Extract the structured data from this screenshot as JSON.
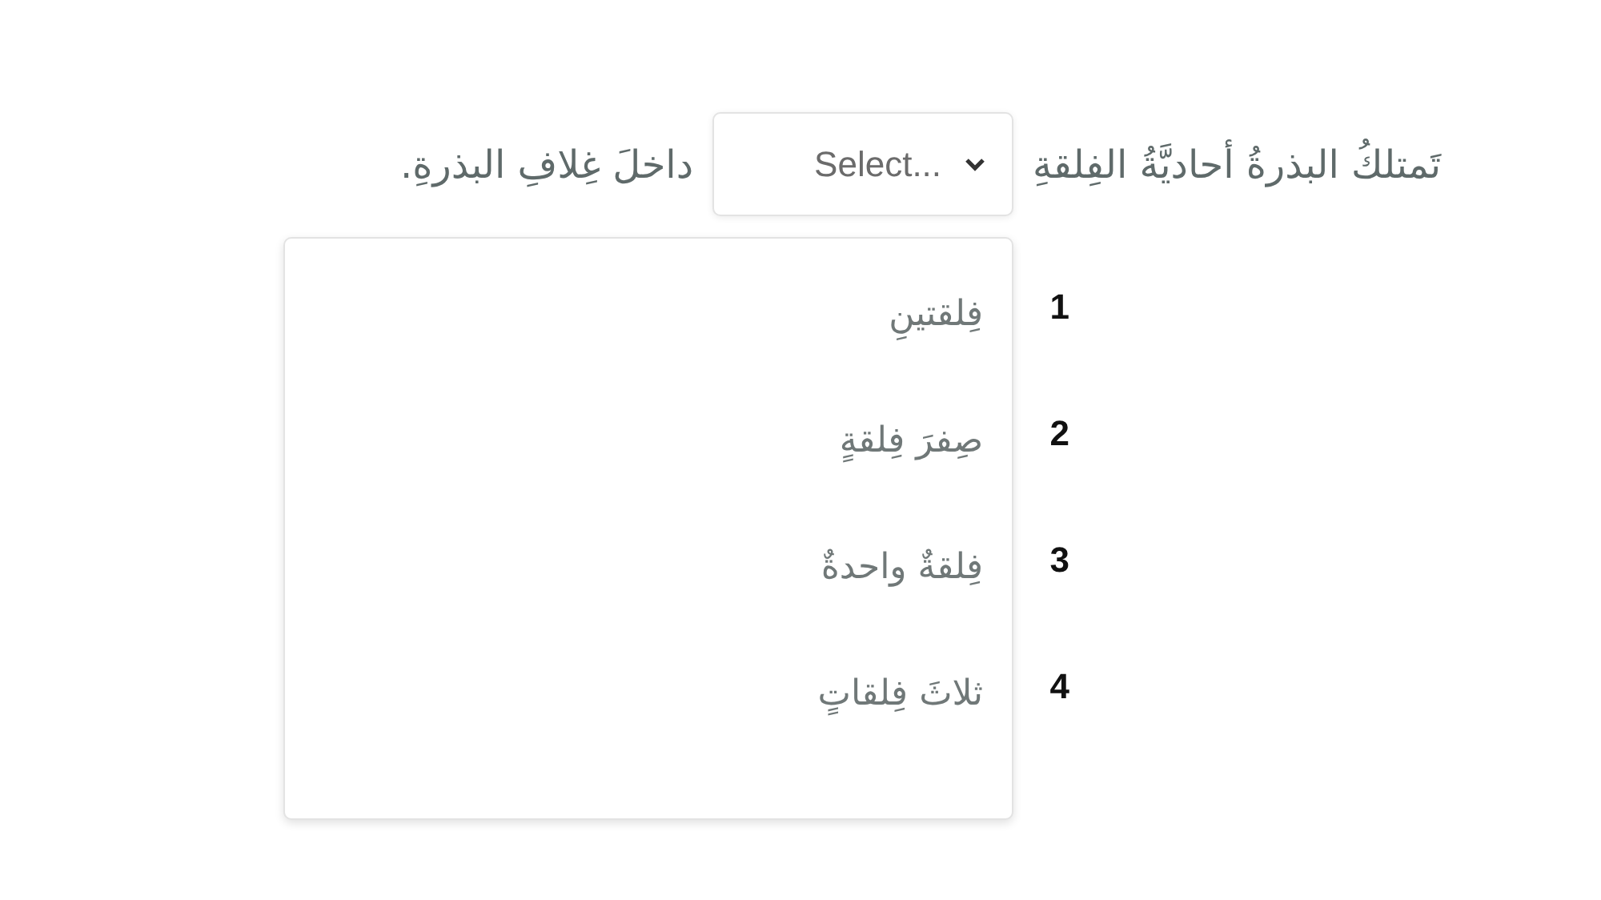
{
  "sentence": {
    "before": "تَمتلكُ البذرةُ أحاديَّةُ الفِلقةِ",
    "after": "داخلَ غِلافِ البذرةِ."
  },
  "select": {
    "placeholder": "Select...",
    "expanded": true
  },
  "options": [
    {
      "number": "1",
      "text": "فِلقتينِ"
    },
    {
      "number": "2",
      "text": "صِفرَ فِلقةٍ"
    },
    {
      "number": "3",
      "text": "فِلقةٌ واحدةٌ"
    },
    {
      "number": "4",
      "text": "ثلاثَ فِلقاتٍ"
    }
  ]
}
